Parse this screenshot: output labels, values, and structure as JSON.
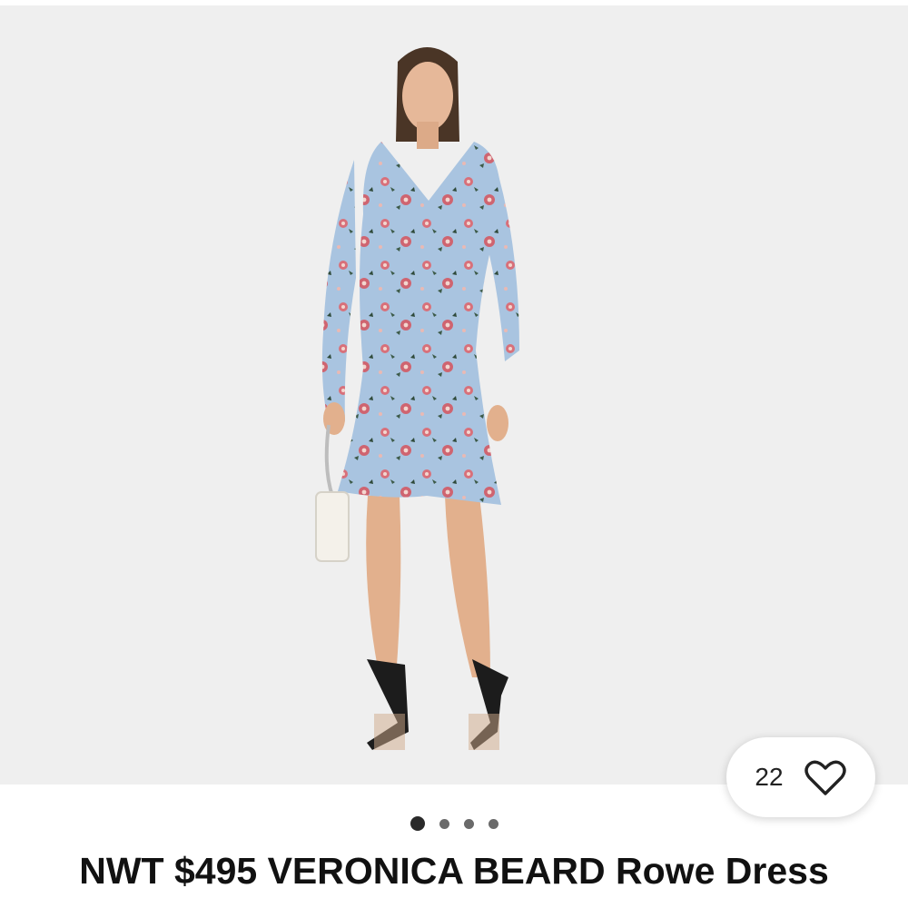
{
  "listing": {
    "title": "NWT $495 VERONICA BEARD Rowe Dress",
    "like_count": "22",
    "like_icon": "heart-outline-icon",
    "carousel": {
      "total_images": 4,
      "active_index": 0
    }
  },
  "colors": {
    "photo_background": "#efefef",
    "dress": "#a9c4e0",
    "print_flower": "#d8707a",
    "text": "#111111"
  }
}
